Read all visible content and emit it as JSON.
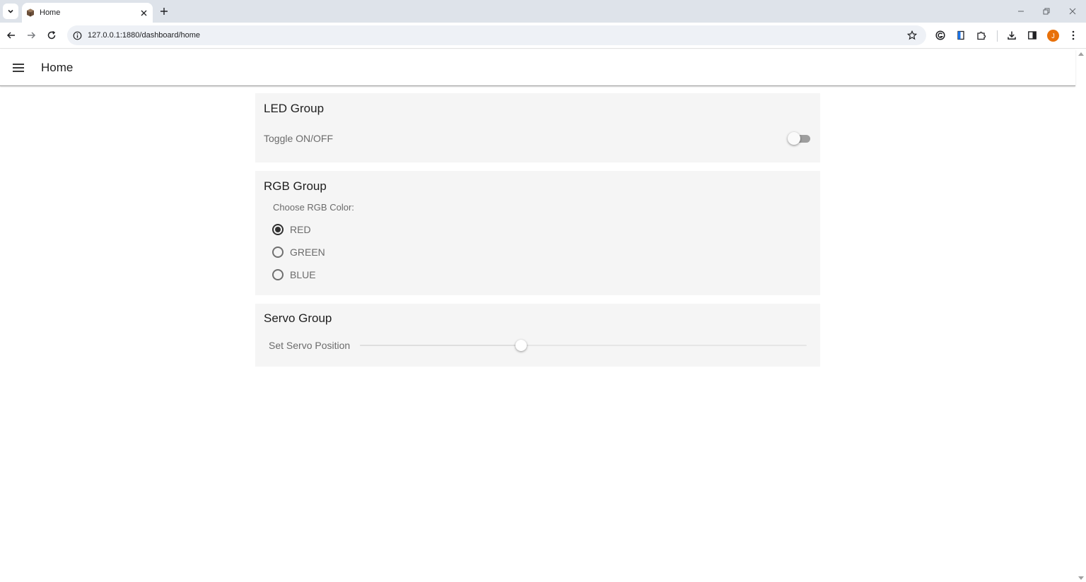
{
  "browser": {
    "tab_title": "Home",
    "url": "127.0.0.1:1880/dashboard/home",
    "profile_initial": "J",
    "icons": {
      "tab_search": "chevron-down-icon",
      "favicon": "node-red-cube-icon",
      "tab_close": "close-icon",
      "new_tab": "plus-icon",
      "back": "arrow-left-icon",
      "forward": "arrow-right-icon",
      "reload": "reload-icon",
      "site_info": "info-icon",
      "bookmark": "star-icon",
      "extensions": "puzzle-icon",
      "downloads": "download-icon",
      "side_panel": "side-panel-icon",
      "menu": "kebab-menu-icon"
    },
    "avatar_color": "#e8710a"
  },
  "dashboard": {
    "page_title": "Home",
    "menu_icon": "hamburger-menu-icon",
    "led_group": {
      "title": "LED Group",
      "toggle_label": "Toggle ON/OFF",
      "toggle_on": false
    },
    "rgb_group": {
      "title": "RGB Group",
      "prompt": "Choose RGB Color:",
      "options": [
        "RED",
        "GREEN",
        "BLUE"
      ],
      "selected": "RED"
    },
    "servo_group": {
      "title": "Servo Group",
      "slider_label": "Set Servo Position",
      "slider_fraction": 0.36
    }
  }
}
